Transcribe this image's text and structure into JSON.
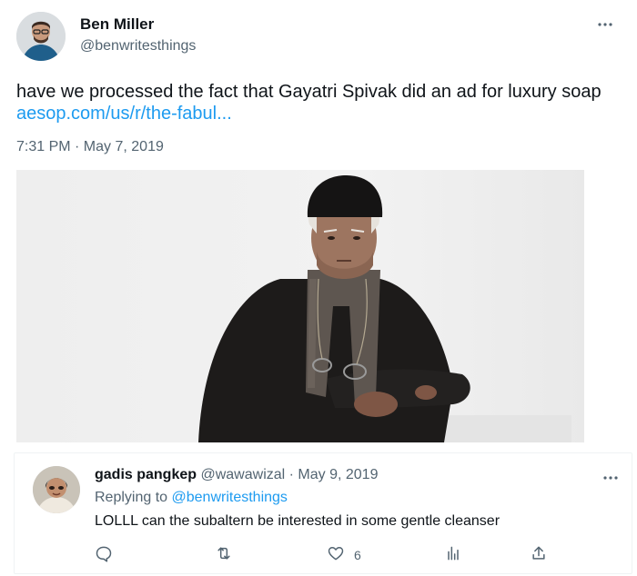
{
  "tweet": {
    "author_name": "Ben Miller",
    "author_handle": "@benwritesthings",
    "more_icon": "more-horizontal-icon",
    "text": "have we processed the fact that Gayatri Spivak did an ad for luxury soap",
    "link": "aesop.com/us/r/the-fabul...",
    "meta": "7:31 PM · May 7, 2019",
    "photo_icon": "photo"
  },
  "reply": {
    "author_name": "gadis pangkep",
    "author_handle": "@wawawizal",
    "separator": " · ",
    "date": "May 9, 2019",
    "replying_prefix": "Replying to ",
    "replying_to": "@benwritesthings",
    "text": "LOLLL can the subaltern be interested in some gentle cleanser",
    "actions": {
      "reply_icon": "reply-icon",
      "retweet_icon": "retweet-icon",
      "like_icon": "heart-icon",
      "like_count": "6",
      "views_icon": "analytics-icon",
      "share_icon": "share-icon"
    }
  },
  "colors": {
    "link": "#1d9bf0",
    "secondary_text": "#536471",
    "primary_text": "#0f1419"
  }
}
